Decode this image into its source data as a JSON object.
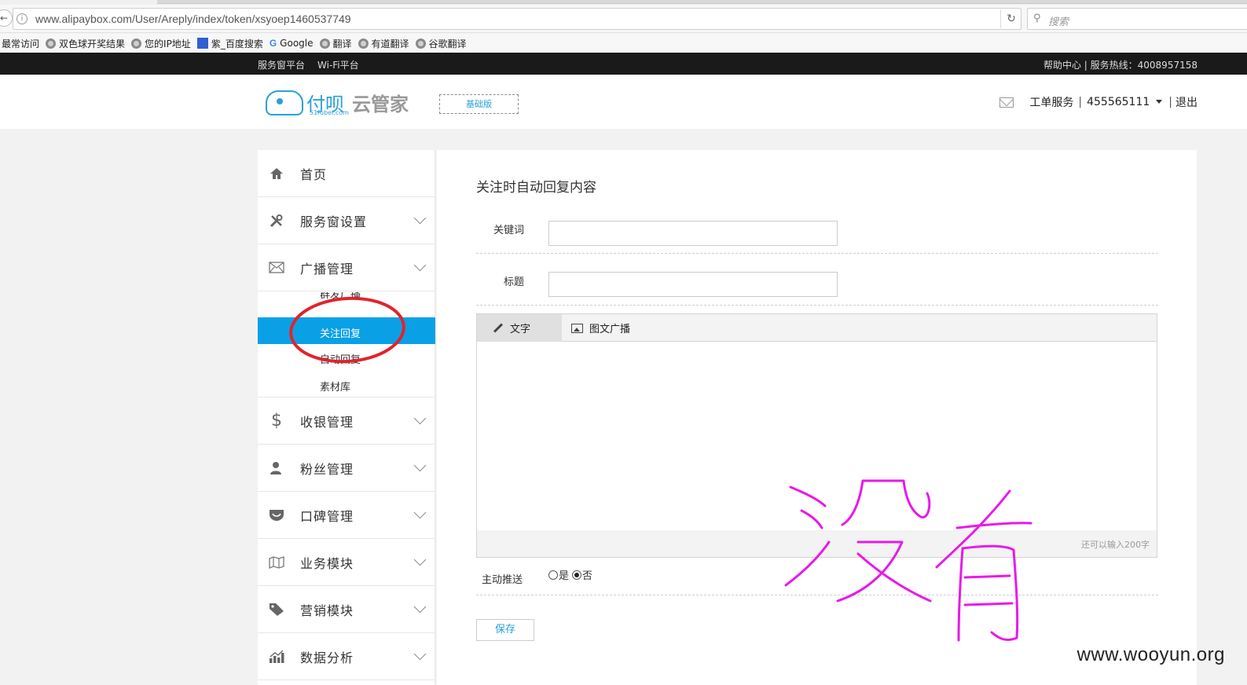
{
  "browser": {
    "url": "www.alipaybox.com/User/Areply/index/token/xsyoep1460537749",
    "search_placeholder": "搜索",
    "bookmarks": [
      "最常访问",
      "双色球开奖结果",
      "您的IP地址",
      "紫_百度搜索",
      "Google",
      "翻译",
      "有道翻译",
      "谷歌翻译"
    ]
  },
  "topbar": {
    "links": [
      "服务窗平台",
      "Wi-Fi平台"
    ],
    "right_text": "帮助中心 | 服务热线：4008957158"
  },
  "header": {
    "logo_text": "付呗",
    "logo_sub": "51fubei.com",
    "logo_product": "云管家",
    "edition": "基础版",
    "ticket_service": "工单服务",
    "account": "455565111",
    "logout": "退出"
  },
  "sidebar": {
    "items": [
      {
        "label": "首页",
        "icon": "home-icon"
      },
      {
        "label": "服务窗设置",
        "icon": "tools-icon"
      },
      {
        "label": "广播管理",
        "icon": "envelope-icon"
      },
      {
        "label": "收银管理",
        "icon": "dollar-icon"
      },
      {
        "label": "粉丝管理",
        "icon": "user-icon"
      },
      {
        "label": "口碑管理",
        "icon": "shield-icon"
      },
      {
        "label": "业务模块",
        "icon": "map-icon"
      },
      {
        "label": "营销模块",
        "icon": "tag-icon"
      },
      {
        "label": "数据分析",
        "icon": "chart-icon"
      }
    ],
    "submenu": [
      "群发广播",
      "关注回复",
      "自动回复",
      "素材库"
    ],
    "active_submenu": "关注回复"
  },
  "main": {
    "title": "关注时自动回复内容",
    "keyword_label": "关键词",
    "title_label": "标题",
    "tabs": [
      "文字",
      "图文广播"
    ],
    "char_count": "还可以输入200字",
    "push_label": "主动推送",
    "push_yes": "是",
    "push_no": "否",
    "push_selected": "否",
    "save_label": "保存"
  },
  "watermark": "www.wooyun.org",
  "colors": {
    "accent": "#0aa0e6",
    "annotation_circle": "#e0242b",
    "annotation_text": "#e81ae8"
  }
}
